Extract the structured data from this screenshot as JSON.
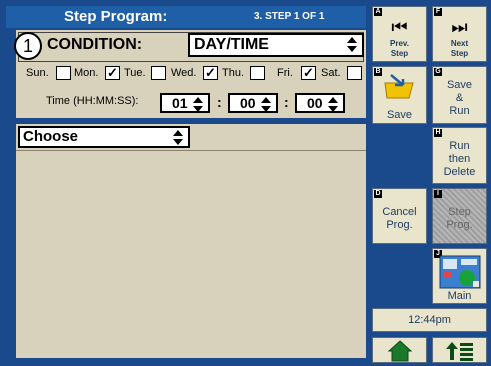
{
  "title": "Step Program:",
  "step_info": "3. STEP  1  OF  1",
  "condition": {
    "step_number": "1",
    "label": "CONDITION:",
    "value": "DAY/TIME"
  },
  "days": [
    {
      "label": "Sun.",
      "checked": false
    },
    {
      "label": "Mon.",
      "checked": true
    },
    {
      "label": "Tue.",
      "checked": false
    },
    {
      "label": "Wed.",
      "checked": true
    },
    {
      "label": "Thu.",
      "checked": false
    },
    {
      "label": "Fri.",
      "checked": true
    },
    {
      "label": "Sat.",
      "checked": false
    }
  ],
  "time": {
    "label": "Time (HH:MM:SS):",
    "hh": "01",
    "mm": "00",
    "ss": "00"
  },
  "choose": {
    "value": "Choose"
  },
  "buttons": {
    "prev": {
      "key": "A",
      "label1": "Prev.",
      "label2": "Step"
    },
    "next": {
      "key": "F",
      "label1": "Next",
      "label2": "Step"
    },
    "save": {
      "key": "B",
      "label": "Save"
    },
    "save_run": {
      "key": "G",
      "label1": "Save",
      "label2": "&",
      "label3": "Run"
    },
    "run_delete": {
      "key": "H",
      "label1": "Run",
      "label2": "then",
      "label3": "Delete"
    },
    "cancel": {
      "key": "D",
      "label1": "Cancel",
      "label2": "Prog."
    },
    "step_prog": {
      "key": "I",
      "label1": "Step",
      "label2": "Prog."
    },
    "main": {
      "key": "J",
      "label": "Main"
    }
  },
  "clock": "12:44pm",
  "icons": {
    "home": "home-icon",
    "up_grid": "up-grid-icon"
  }
}
